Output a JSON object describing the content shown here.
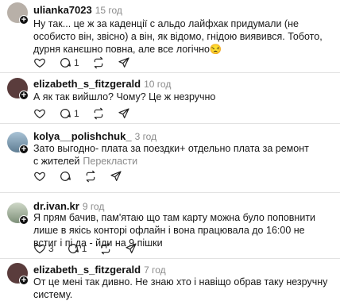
{
  "posts": [
    {
      "username": "ulianka7023",
      "time": "15 год",
      "text": "Ну так... це ж за каденції с  альдо лайфхак придумали (не особисто він, звісно) а він, як відомо, гнідою виявився. Тобото, дурня канєшно повна, але все логічно😒",
      "likes": "",
      "replies": "1",
      "avatar_color": "#b8b0a8"
    },
    {
      "username": "elizabeth_s_fitzgerald",
      "time": "10 год",
      "text": "А як так вийшло? Чому? Це ж незручно",
      "likes": "",
      "replies": "1",
      "avatar_color": "#5a3c3c"
    },
    {
      "username": "kolya__polishchuk_",
      "time": "3 год",
      "text": "Зато выгодно- плата за поездки+ отдельно плата за ремонт с жителей",
      "translate": "Перекласти",
      "likes": "",
      "replies": "",
      "avatar_color": "#6f8fa8"
    },
    {
      "username": "dr.ivan.kr",
      "time": "9 год",
      "text": "Я прям бачив, пам'ятаю що там карту можна було поповнити лише в якісь конторі офлайн і вона працювала до 16:00 не встиг і пі  да - йди на 9 пішки",
      "likes": "3",
      "replies": "1",
      "avatar_color": "#8da08a"
    },
    {
      "username": "elizabeth_s_fitzgerald",
      "time": "7 год",
      "text": "От це мені так дивно. Не знаю хто і навіщо обрав таку незручну систему.",
      "likes": "",
      "replies": "",
      "avatar_color": "#5a3c3c"
    }
  ],
  "icons": {
    "like": "heart-icon",
    "reply": "comment-icon",
    "repost": "repost-icon",
    "share": "share-icon",
    "follow": "plus-icon"
  }
}
